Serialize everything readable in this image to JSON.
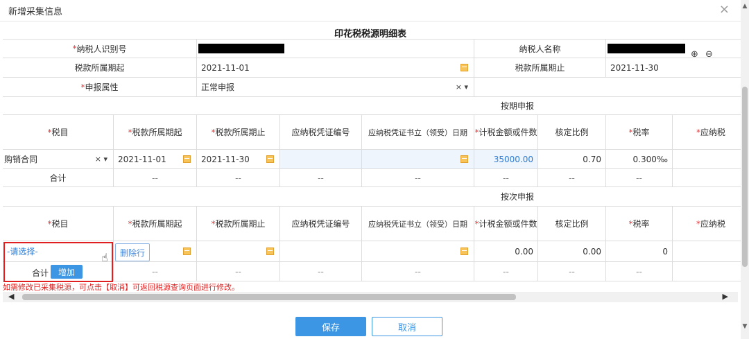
{
  "dialog": {
    "title": "新增采集信息",
    "close_icon": "close-icon"
  },
  "form_title": "印花税税源明细表",
  "header": {
    "taxpayer_id_label": "纳税人识别号",
    "taxpayer_name_label": "纳税人名称",
    "period_start_label": "税款所属期起",
    "period_start_value": "2021-11-01",
    "period_end_label": "税款所属期止",
    "period_end_value": "2021-11-30",
    "declare_attr_label": "申报属性",
    "declare_attr_value": "正常申报"
  },
  "periodic": {
    "section_title": "按期申报",
    "columns": [
      "税目",
      "税款所属期起",
      "税款所属期止",
      "应纳税凭证编号",
      "应纳税凭证书立（领受）日期",
      "计税金额或件数",
      "核定比例",
      "税率",
      "应纳税"
    ],
    "row": {
      "item": "购销合同",
      "start": "2021-11-01",
      "end": "2021-11-30",
      "cert_no": "",
      "cert_date": "",
      "amount": "35000.00",
      "ratio": "0.70",
      "rate": "0.300‰"
    },
    "total_label": "合计",
    "dash": "--"
  },
  "per_item": {
    "section_title": "按次申报",
    "columns": [
      "税目",
      "税款所属期起",
      "税款所属期止",
      "应纳税凭证编号",
      "应纳税凭证书立（领受）日期",
      "计税金额或件数",
      "核定比例",
      "税率",
      "应纳税"
    ],
    "row": {
      "item_placeholder": "-请选择-",
      "amount": "0.00",
      "ratio": "0.00",
      "rate": "0"
    },
    "delete_row_label": "删除行",
    "total_label": "合计",
    "add_label": "增加",
    "dash": "--"
  },
  "hint": "如需修改已采集税源，可点击【取消】可返回税源查询页面进行修改。",
  "buttons": {
    "save": "保存",
    "cancel": "取消"
  },
  "colors": {
    "accent": "#3d96e4",
    "required": "#e4393c",
    "highlight_outline": "#e02020"
  },
  "required_mark": "*",
  "clear_mark": "×",
  "dropdown_mark": "▾"
}
